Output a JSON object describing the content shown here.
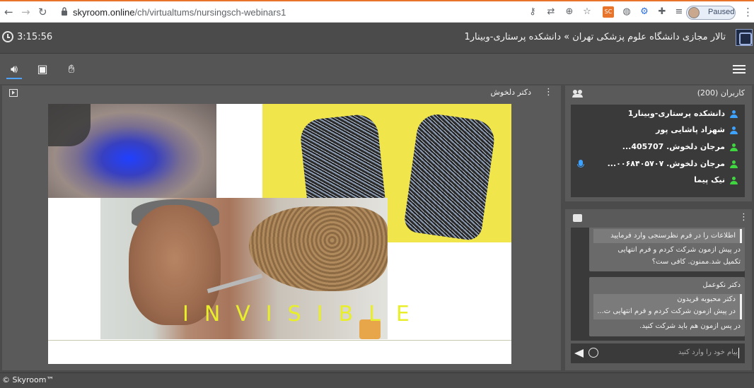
{
  "browser": {
    "url_host": "skyroom.online",
    "url_path": "/ch/virtualtums/nursingsch-webinars1",
    "profile_status": "Paused",
    "extension_badge": "SC"
  },
  "header": {
    "timer": "3:15:56",
    "room_title": "تالار مجازی دانشگاه علوم پزشکی تهران » دانشکده پرستاری-وبینار1"
  },
  "main": {
    "presenter": "دکتر دلخوش",
    "slide_caption": "INVISIBLE"
  },
  "users": {
    "header": "کاربران (200)",
    "list": [
      {
        "name": "دانشکده پرستاری-وبینار1",
        "color": "#3ea3ff",
        "mic": false
      },
      {
        "name": "شهزاد پاشایی پور",
        "color": "#3ea3ff",
        "mic": false
      },
      {
        "name": "مرجان دلخوش. 405707...",
        "color": "#3fd63f",
        "mic": false
      },
      {
        "name": "مرجان دلخوش. ۰۰۶۸۴۰۵۷۰۷...",
        "color": "#3fd63f",
        "mic": true
      },
      {
        "name": "نیک پیما",
        "color": "#3fd63f",
        "mic": false
      }
    ]
  },
  "chat": {
    "messages": [
      {
        "quote": "اطلاعات  را در فرم نظرسنجی وارد فرمایید",
        "lines": [
          "در پیش ازمون شرکت کردم و فرم انتهایی",
          "تکمیل شد.ممنون. کافی ست؟"
        ]
      },
      {
        "author": "دکتر نکوعمل",
        "quote_lines": [
          "دکتر محبوبه فریدون",
          "در پیش ازمون شرکت کردم و فرم انتهایی ت..."
        ],
        "lines": [
          "در پس ازمون هم باید شرکت کنید."
        ]
      }
    ],
    "placeholder": "پیام خود را وارد کنید"
  },
  "footer": {
    "copyright": "© Skyroom™"
  }
}
